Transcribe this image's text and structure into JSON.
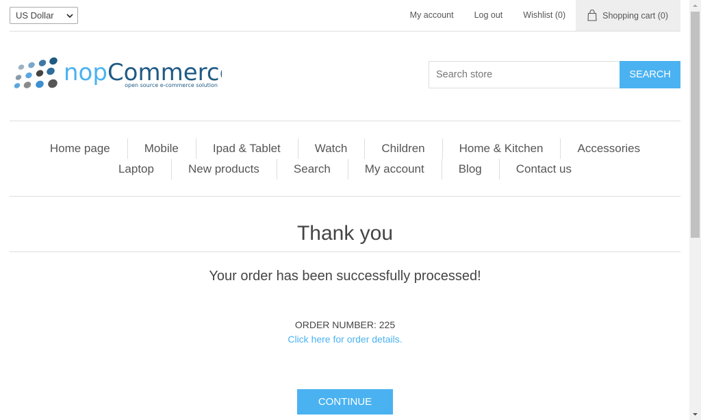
{
  "header": {
    "currency": "US Dollar",
    "links": {
      "my_account": "My account",
      "log_out": "Log out",
      "wishlist": "Wishlist (0)",
      "shopping_cart": "Shopping cart (0)"
    }
  },
  "logo": {
    "brand": "nopCommerce",
    "tagline": "open source e-commerce solution"
  },
  "search": {
    "placeholder": "Search store",
    "button_label": "Search"
  },
  "menu": {
    "row1": [
      "Home page",
      "Mobile",
      "Ipad & Tablet",
      "Watch",
      "Children",
      "Home & Kitchen",
      "Accessories"
    ],
    "row2": [
      "Laptop",
      "New products",
      "Search",
      "My account",
      "Blog",
      "Contact us"
    ]
  },
  "main": {
    "title": "Thank you",
    "success_message": "Your order has been successfully processed!",
    "order_number": "ORDER NUMBER: 225",
    "order_details_link": "Click here for order details.",
    "continue_label": "Continue"
  },
  "colors": {
    "accent": "#4ab2f1",
    "text": "#444444",
    "border": "#dddddd"
  }
}
